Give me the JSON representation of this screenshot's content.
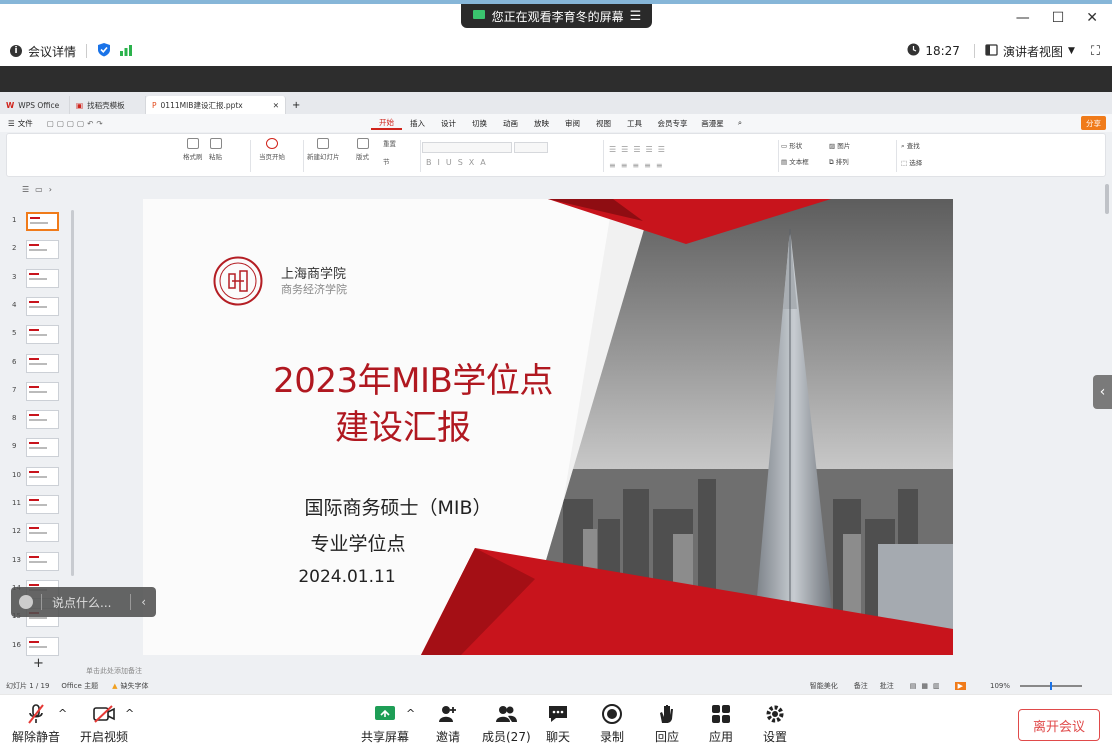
{
  "meeting": {
    "banner_text": "您正在观看李育冬的屏幕",
    "info_label": "会议详情",
    "time": "18:27",
    "view_mode": "演讲者视图"
  },
  "wps": {
    "tabs": [
      {
        "label": "WPS Office"
      },
      {
        "label": "找稻壳模板"
      },
      {
        "label": "0111MIB建设汇报.pptx"
      }
    ],
    "file_menu": "文件",
    "menu": [
      "开始",
      "插入",
      "设计",
      "切换",
      "动画",
      "放映",
      "审阅",
      "视图",
      "工具",
      "会员专享",
      "画漫星"
    ],
    "share": "分享",
    "ribbon": {
      "format_painter": "格式刷",
      "paste": "粘贴",
      "play_from_current": "当页开始",
      "new_slide": "新建幻灯片",
      "layout": "版式",
      "reset": "重置",
      "section": "节",
      "shape": "形状",
      "picture": "图片",
      "textbox": "文本框",
      "arrange": "排列",
      "find": "查找",
      "select": "选择"
    },
    "notes_placeholder": "单击此处添加备注",
    "status": {
      "slide_counter": "幻灯片 1 / 19",
      "theme": "Office 主题",
      "missing_font": "缺失字体",
      "smart_beautify": "智能美化",
      "notes": "备注",
      "comments": "批注",
      "zoom": "109%"
    },
    "thumbnails": [
      "1",
      "2",
      "3",
      "4",
      "5",
      "6",
      "7",
      "8",
      "9",
      "10",
      "11",
      "12",
      "13",
      "14",
      "15",
      "16"
    ]
  },
  "slide": {
    "school_name": "上海商学院",
    "college_name": "商务经济学院",
    "title_line1": "2023年MIB学位点",
    "title_line2": "建设汇报",
    "subtitle_line1": "国际商务硕士（MIB）",
    "subtitle_line2": "专业学位点",
    "date": "2024.01.11"
  },
  "chat": {
    "placeholder": "说点什么..."
  },
  "toolbar": {
    "unmute": "解除静音",
    "start_video": "开启视频",
    "share_screen": "共享屏幕",
    "invite": "邀请",
    "members": "成员(27)",
    "chat": "聊天",
    "record": "录制",
    "reactions": "回应",
    "apps": "应用",
    "settings": "设置",
    "leave": "离开会议"
  },
  "colors": {
    "accent_red": "#c8141c",
    "brand_blue": "#1a73e8",
    "leave_red": "#e04a4a"
  }
}
